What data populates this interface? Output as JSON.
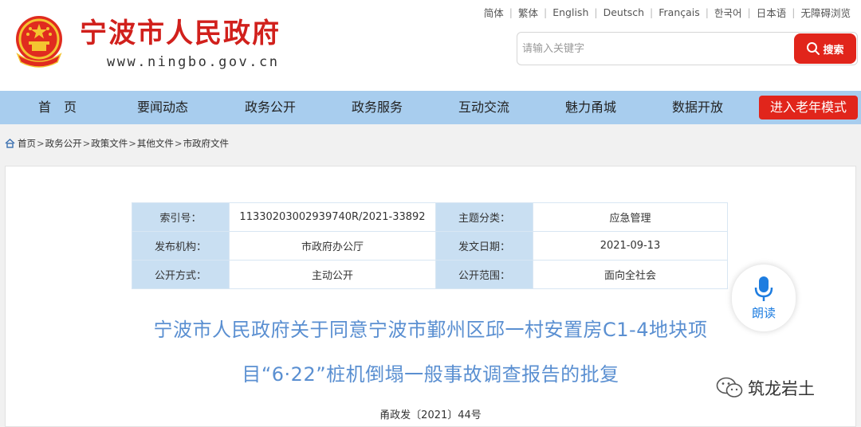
{
  "header": {
    "site_title": "宁波市人民政府",
    "site_url": "www.ningbo.gov.cn",
    "languages": [
      "简体",
      "繁体",
      "English",
      "Deutsch",
      "Français",
      "한국어",
      "日本语",
      "无障碍浏览"
    ],
    "search": {
      "placeholder": "请输入关键字",
      "value": "",
      "button_label": "搜索"
    }
  },
  "nav": {
    "items": [
      "首　页",
      "要闻动态",
      "政务公开",
      "政务服务",
      "互动交流",
      "魅力甬城",
      "数据开放"
    ],
    "elderly_mode": "进入老年模式"
  },
  "breadcrumb": [
    "首页",
    "政务公开",
    "政策文件",
    "其他文件",
    "市政府文件"
  ],
  "meta": {
    "index_no_label": "索引号：",
    "index_no": "11330203002939740R/2021-33892",
    "topic_label": "主题分类：",
    "topic": "应急管理",
    "issuer_label": "发布机构：",
    "issuer": "市政府办公厅",
    "date_label": "发文日期：",
    "date": "2021-09-13",
    "open_mode_label": "公开方式：",
    "open_mode": "主动公开",
    "scope_label": "公开范围：",
    "scope": "面向全社会"
  },
  "voice": {
    "label": "朗读"
  },
  "document": {
    "title_line1": "宁波市人民政府关于同意宁波市鄞州区邱一村安置房C1-4地块项",
    "title_line2": "目“6·22”桩机倒塌一般事故调查报告的批复",
    "doc_number": "甬政发〔2021〕44号"
  },
  "watermark": {
    "text": "筑龙岩土"
  },
  "colors": {
    "brand_red": "#d1201c",
    "button_red": "#e1251b",
    "nav_blue": "#a8cdee",
    "title_blue": "#5a8fd1"
  }
}
